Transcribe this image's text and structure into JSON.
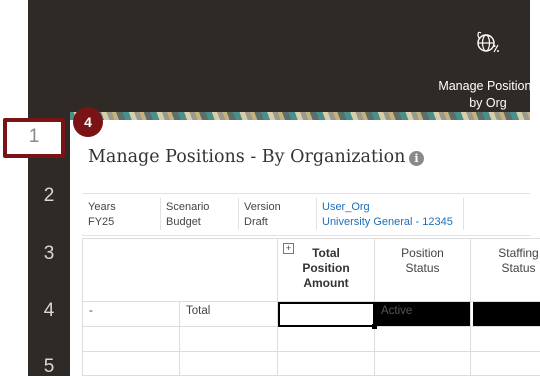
{
  "tile": {
    "label_line1": "Manage Positions",
    "label_line2": "by Org",
    "icon": "globe-icon"
  },
  "row_numbers": [
    "1",
    "2",
    "3",
    "4",
    "5"
  ],
  "highlight": {
    "number": "1",
    "badge": "4",
    "color": "#7a1315"
  },
  "page": {
    "title": "Manage Positions - By Organization",
    "info_icon": "info-icon"
  },
  "pov": {
    "years_label": "Years",
    "years_value": "FY25",
    "scenario_label": "Scenario",
    "scenario_value": "Budget",
    "version_label": "Version",
    "version_value": "Draft",
    "org_label": "User_Org",
    "org_value": "University General - 12345"
  },
  "grid": {
    "expand_symbol": "+",
    "col_total_line1": "Total",
    "col_total_line2": "Position",
    "col_total_line3": "Amount",
    "col_status_line1": "Position",
    "col_status_line2": "Status",
    "col_staffing_line1": "Staffing",
    "col_staffing_line2": "Status",
    "row1_col1": "-",
    "row1_col2": "Total",
    "row1_status": "Active"
  },
  "colors": {
    "header_bg": "#2f2a25",
    "link": "#1d6fb8",
    "selected_bg": "#000000"
  }
}
